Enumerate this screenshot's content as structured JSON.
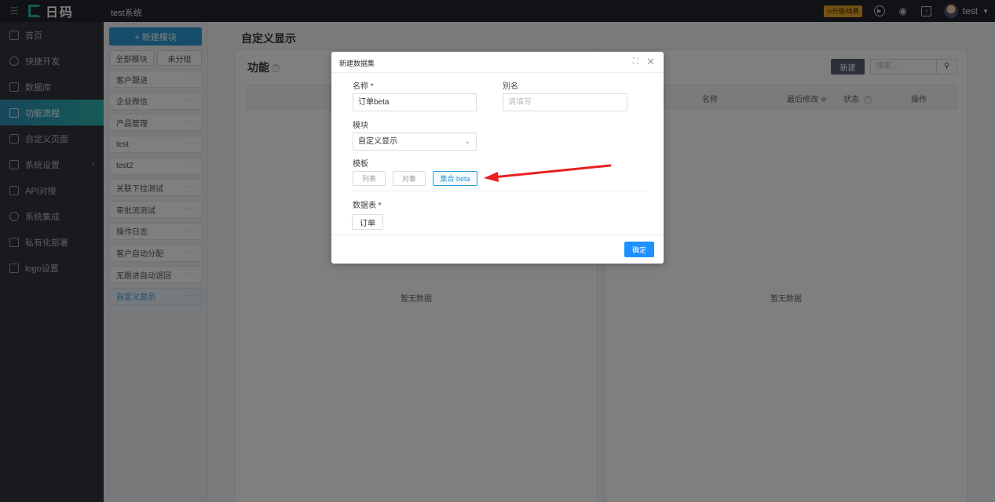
{
  "topbar": {
    "logo_text": "日码",
    "system_name": "test系统",
    "upgrade_label": "⊙升级/续费",
    "user_name": "test"
  },
  "sidebar": {
    "items": [
      {
        "label": "首页",
        "icon": "home-icon"
      },
      {
        "label": "快捷开发",
        "icon": "dev-icon"
      },
      {
        "label": "数据库",
        "icon": "database-icon"
      },
      {
        "label": "功能流程",
        "icon": "flow-icon",
        "active": true
      },
      {
        "label": "自定义页面",
        "icon": "page-icon"
      },
      {
        "label": "系统设置",
        "icon": "settings-icon"
      },
      {
        "label": "API对接",
        "icon": "api-icon"
      },
      {
        "label": "系统集成",
        "icon": "integration-icon"
      },
      {
        "label": "私有化部署",
        "icon": "deploy-icon"
      },
      {
        "label": "logo设置",
        "icon": "logo-icon"
      }
    ]
  },
  "modules": {
    "new_button": "+ 新建模块",
    "filter_all": "全部模块",
    "filter_ungrouped": "未分组",
    "items": [
      "客户跟进",
      "企业微信",
      "产品管理",
      "test",
      "test2",
      "关联下拉测试",
      "审批流测试",
      "操作日志",
      "客户自动分配",
      "无跟进自动退回",
      "自定义显示"
    ]
  },
  "main": {
    "page_title": "自定义显示",
    "left_panel": {
      "title": "功能",
      "empty_text": "暂无数据"
    },
    "right_panel": {
      "new_button": "新建",
      "search_placeholder": "搜索...",
      "columns": [
        "名称",
        "最后修改 ≑",
        "状态",
        "操作"
      ],
      "empty_text": "暂无数据"
    }
  },
  "modal": {
    "title": "新建数据集",
    "name_label": "名称 *",
    "name_value": "订单beta",
    "alias_label": "别名",
    "alias_placeholder": "请填写",
    "module_label": "模块",
    "module_value": "自定义显示",
    "template_label": "模板",
    "templates": [
      "列表",
      "对象",
      "集合 beta"
    ],
    "selected_template": "集合 beta",
    "datatable_label": "数据表 *",
    "datatable_value": "订单",
    "confirm_label": "确定"
  },
  "colors": {
    "accent": "#2a9bd7",
    "annotation_arrow": "#e8211f"
  }
}
